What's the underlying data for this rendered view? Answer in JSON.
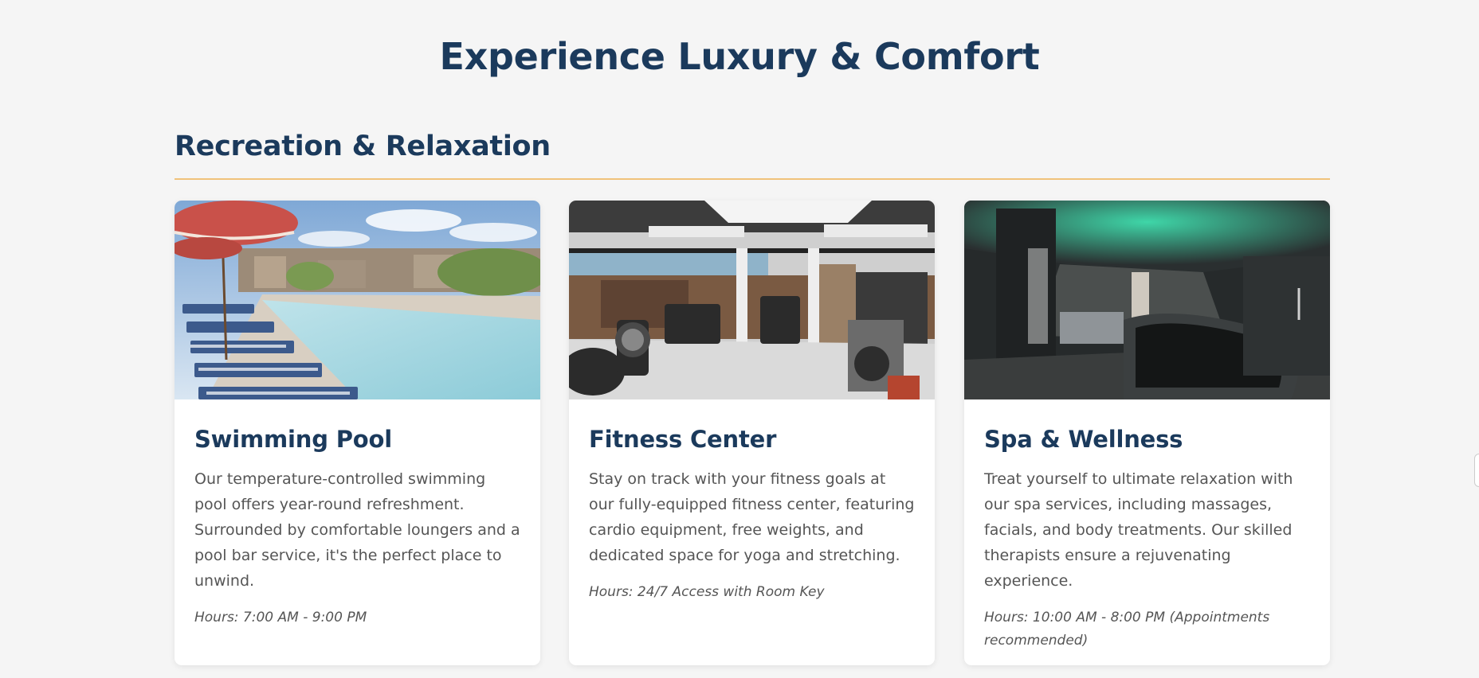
{
  "page": {
    "title": "Experience Luxury & Comfort"
  },
  "section": {
    "title": "Recreation & Relaxation"
  },
  "cards": [
    {
      "title": "Swimming Pool",
      "description": "Our temperature-controlled swimming pool offers year-round refreshment. Surrounded by comfortable loungers and a pool bar service, it's the perfect place to unwind.",
      "hours": "Hours: 7:00 AM - 9:00 PM"
    },
    {
      "title": "Fitness Center",
      "description": "Stay on track with your fitness goals at our fully-equipped fitness center, featuring cardio equipment, free weights, and dedicated space for yoga and stretching.",
      "hours": "Hours: 24/7 Access with Room Key"
    },
    {
      "title": "Spa & Wellness",
      "description": "Treat yourself to ultimate relaxation with our spa services, including massages, facials, and body treatments. Our skilled therapists ensure a rejuvenating experience.",
      "hours": "Hours: 10:00 AM - 8:00 PM (Appointments recommended)"
    }
  ],
  "colors": {
    "heading": "#1b3a5c",
    "accent_rule": "#f0c27b",
    "body_text": "#555555",
    "background": "#f5f5f5"
  }
}
